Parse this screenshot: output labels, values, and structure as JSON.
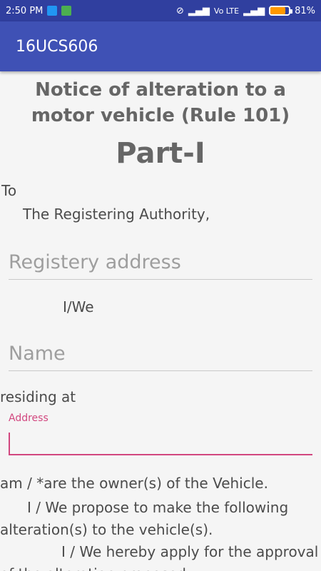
{
  "status_bar": {
    "time": "2:50 PM",
    "network_label": "Vo LTE",
    "battery_percent": "81%",
    "battery_level": 0.81,
    "icons": [
      "usb-icon",
      "android-icon",
      "silent-icon",
      "signal-icon",
      "volte-icon",
      "signal-icon",
      "battery-icon"
    ]
  },
  "app_bar": {
    "title": "16UCS606"
  },
  "form": {
    "title": "Notice of alteration to a motor vehicle (Rule 101)",
    "part": "Part-I",
    "to_label": "To",
    "authority": "The Registering Authority,",
    "registry_placeholder": "Registery address",
    "iwe_label": "I/We",
    "name_placeholder": "Name",
    "residing_label": "residing at",
    "address_label": "Address",
    "address_value": "",
    "owner_text": "am / *are the owner(s) of the Vehicle.",
    "propose_text": "I / We propose to make the following alteration(s) to the vehicle(s).",
    "apply_text": "I / We hereby apply for the approval of the alteration proposed."
  },
  "colors": {
    "status_bar": "#303f9f",
    "app_bar": "#3f51b5",
    "accent": "#d2477f"
  }
}
